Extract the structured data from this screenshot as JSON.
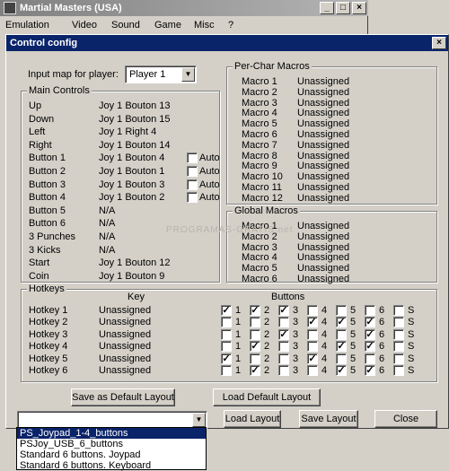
{
  "main_window": {
    "title": "Martial Masters (USA)",
    "menu": [
      "Emulation",
      "Video",
      "Sound",
      "Game",
      "Misc",
      "?"
    ],
    "controls": {
      "minimize": "_",
      "maximize": "□",
      "close": "×"
    }
  },
  "dialog": {
    "title": "Control config",
    "close": "×"
  },
  "input_map": {
    "label": "Input map for player:",
    "value": "Player 1"
  },
  "main_controls": {
    "title": "Main Controls",
    "auto_label": "Auto",
    "rows": [
      {
        "name": "Up",
        "binding": "Joy 1 Bouton 13"
      },
      {
        "name": "Down",
        "binding": "Joy 1 Bouton 15"
      },
      {
        "name": "Left",
        "binding": "Joy 1 Right 4"
      },
      {
        "name": "Right",
        "binding": "Joy 1 Bouton 14"
      },
      {
        "name": "Button 1",
        "binding": "Joy 1 Bouton 4",
        "auto": false
      },
      {
        "name": "Button 2",
        "binding": "Joy 1 Bouton 1",
        "auto": false
      },
      {
        "name": "Button 3",
        "binding": "Joy 1 Bouton 3",
        "auto": false
      },
      {
        "name": "Button 4",
        "binding": "Joy 1 Bouton 2",
        "auto": false
      },
      {
        "name": "Button 5",
        "binding": "N/A"
      },
      {
        "name": "Button 6",
        "binding": "N/A"
      },
      {
        "name": "3 Punches",
        "binding": "N/A"
      },
      {
        "name": "3 Kicks",
        "binding": "N/A"
      },
      {
        "name": "Start",
        "binding": "Joy 1 Bouton 12"
      },
      {
        "name": "Coin",
        "binding": "Joy 1 Bouton 9"
      }
    ]
  },
  "per_char_macros": {
    "title": "Per-Char Macros",
    "rows": [
      {
        "name": "Macro 1",
        "value": "Unassigned"
      },
      {
        "name": "Macro 2",
        "value": "Unassigned"
      },
      {
        "name": "Macro 3",
        "value": "Unassigned"
      },
      {
        "name": "Macro 4",
        "value": "Unassigned"
      },
      {
        "name": "Macro 5",
        "value": "Unassigned"
      },
      {
        "name": "Macro 6",
        "value": "Unassigned"
      },
      {
        "name": "Macro 7",
        "value": "Unassigned"
      },
      {
        "name": "Macro 8",
        "value": "Unassigned"
      },
      {
        "name": "Macro 9",
        "value": "Unassigned"
      },
      {
        "name": "Macro 10",
        "value": "Unassigned"
      },
      {
        "name": "Macro 11",
        "value": "Unassigned"
      },
      {
        "name": "Macro 12",
        "value": "Unassigned"
      }
    ]
  },
  "global_macros": {
    "title": "Global Macros",
    "rows": [
      {
        "name": "Macro 1",
        "value": "Unassigned"
      },
      {
        "name": "Macro 2",
        "value": "Unassigned"
      },
      {
        "name": "Macro 3",
        "value": "Unassigned"
      },
      {
        "name": "Macro 4",
        "value": "Unassigned"
      },
      {
        "name": "Macro 5",
        "value": "Unassigned"
      },
      {
        "name": "Macro 6",
        "value": "Unassigned"
      }
    ]
  },
  "hotkeys": {
    "title": "Hotkeys",
    "key_header": "Key",
    "buttons_header": "Buttons",
    "button_labels": [
      "1",
      "2",
      "3",
      "4",
      "5",
      "6",
      "S"
    ],
    "rows": [
      {
        "name": "Hotkey 1",
        "key": "Unassigned",
        "checks": [
          true,
          true,
          true,
          false,
          false,
          false,
          false
        ]
      },
      {
        "name": "Hotkey 2",
        "key": "Unassigned",
        "checks": [
          false,
          false,
          false,
          true,
          true,
          true,
          false
        ]
      },
      {
        "name": "Hotkey 3",
        "key": "Unassigned",
        "checks": [
          false,
          false,
          true,
          false,
          false,
          true,
          false
        ]
      },
      {
        "name": "Hotkey 4",
        "key": "Unassigned",
        "checks": [
          false,
          true,
          false,
          false,
          true,
          true,
          false
        ]
      },
      {
        "name": "Hotkey 5",
        "key": "Unassigned",
        "checks": [
          true,
          false,
          false,
          true,
          false,
          false,
          false
        ]
      },
      {
        "name": "Hotkey 6",
        "key": "Unassigned",
        "checks": [
          false,
          true,
          false,
          false,
          true,
          true,
          false
        ]
      }
    ]
  },
  "buttons": {
    "save_as_default": "Save as  Default Layout",
    "load_default": "Load Default Layout",
    "load_layout": "Load Layout",
    "save_layout": "Save Layout",
    "close": "Close"
  },
  "layout_combo": {
    "value": "",
    "options": [
      "PS_Joypad_1-4_buttons",
      "PSJoy_USB_6_buttons",
      "Standard 6 buttons. Joypad",
      "Standard 6 buttons. Keyboard"
    ],
    "selected_index": 0
  },
  "watermark": "PROGRAMAS-GRATIS.net"
}
